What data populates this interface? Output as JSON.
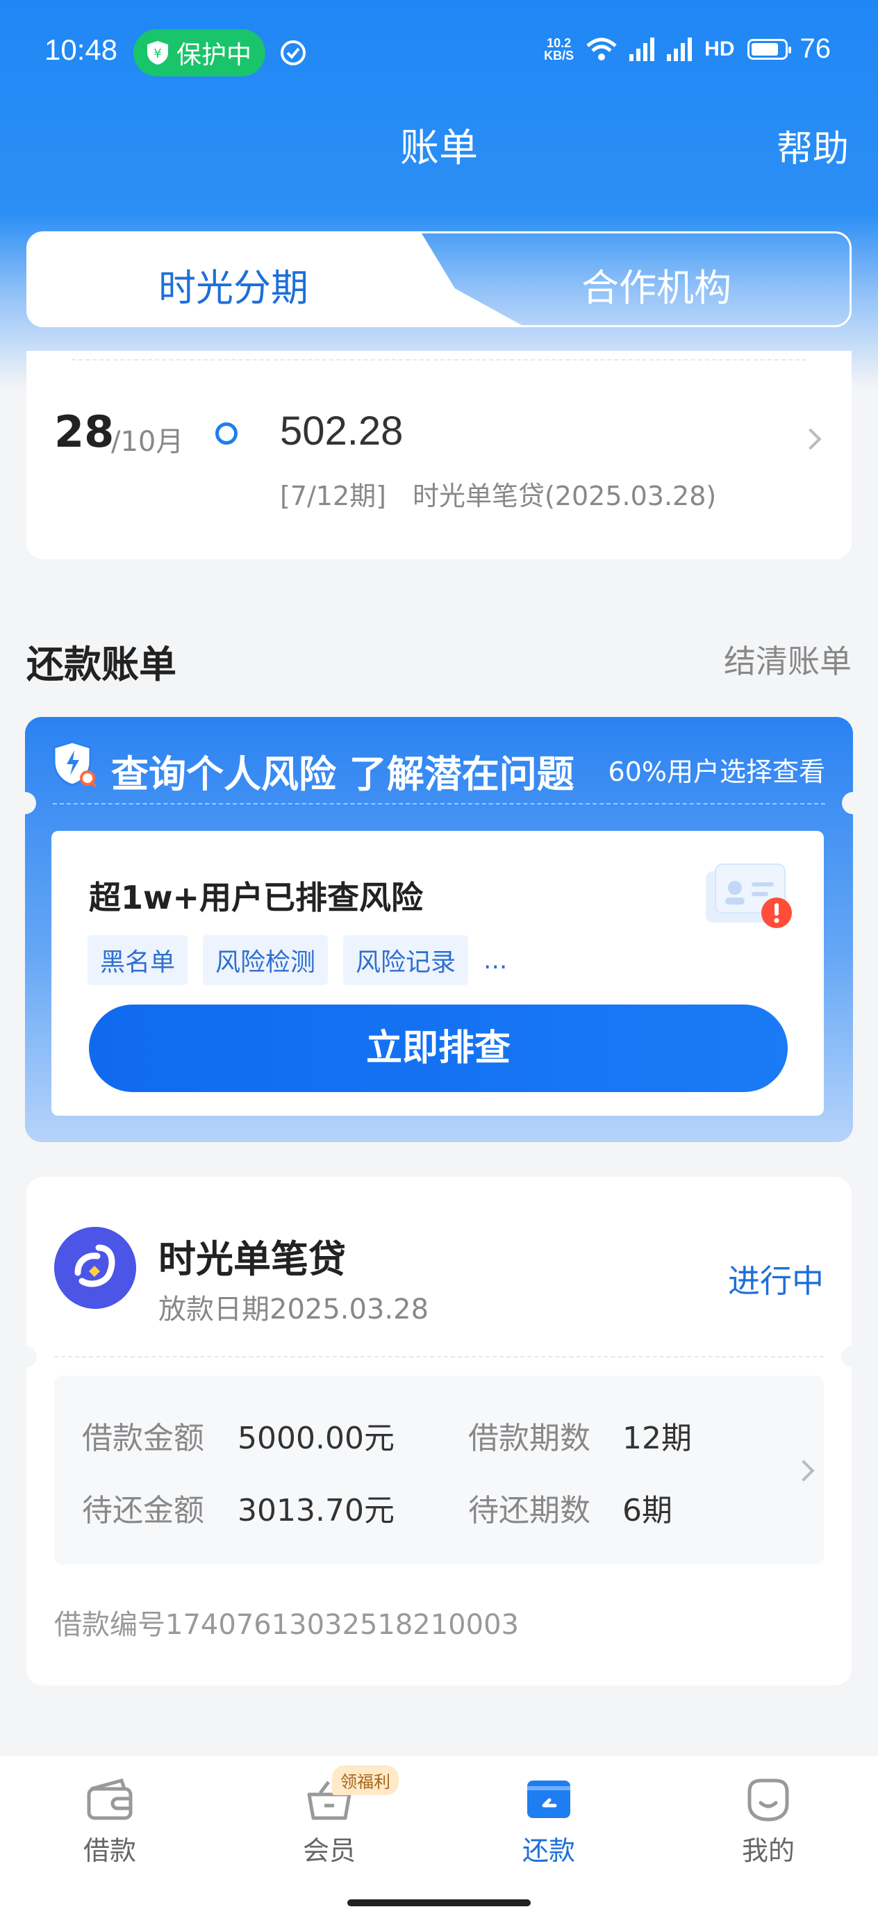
{
  "status_bar": {
    "time": "10:48",
    "protect": "保护中",
    "net_speed_top": "10.2",
    "net_speed_bottom": "KB/S",
    "battery": "76"
  },
  "header": {
    "title": "账单",
    "help": "帮助"
  },
  "tabs": [
    {
      "label": "时光分期",
      "active": true
    },
    {
      "label": "合作机构",
      "active": false
    }
  ],
  "upcoming": {
    "day": "28",
    "month": "/10月",
    "amount": "502.28",
    "detail": "[7/12期]　时光单笔贷(2025.03.28)"
  },
  "section": {
    "title": "还款账单",
    "link": "结清账单"
  },
  "risk_banner": {
    "title": "查询个人风险 了解潜在问题",
    "subtitle": "60%用户选择查看",
    "headline": "超1w+用户已排查风险",
    "tags": [
      "黑名单",
      "风险检测",
      "风险记录"
    ],
    "more": "...",
    "button": "立即排查"
  },
  "loan": {
    "name": "时光单笔贷",
    "date": "放款日期2025.03.28",
    "status": "进行中",
    "rows": [
      {
        "label": "借款金额",
        "value": "5000.00元",
        "label2": "借款期数",
        "value2": "12期"
      },
      {
        "label": "待还金额",
        "value": "3013.70元",
        "label2": "待还期数",
        "value2": "6期"
      }
    ],
    "loan_no": "借款编号17407613032518210003"
  },
  "bottom_nav": {
    "items": [
      {
        "label": "借款",
        "icon": "wallet-icon"
      },
      {
        "label": "会员",
        "icon": "basket-icon",
        "badge": "领福利"
      },
      {
        "label": "还款",
        "icon": "card-icon",
        "active": true
      },
      {
        "label": "我的",
        "icon": "smile-icon"
      }
    ]
  },
  "colors": {
    "primary": "#1e6fd9",
    "brand_blue": "#1f87f5",
    "protect_green": "#19c46a"
  }
}
